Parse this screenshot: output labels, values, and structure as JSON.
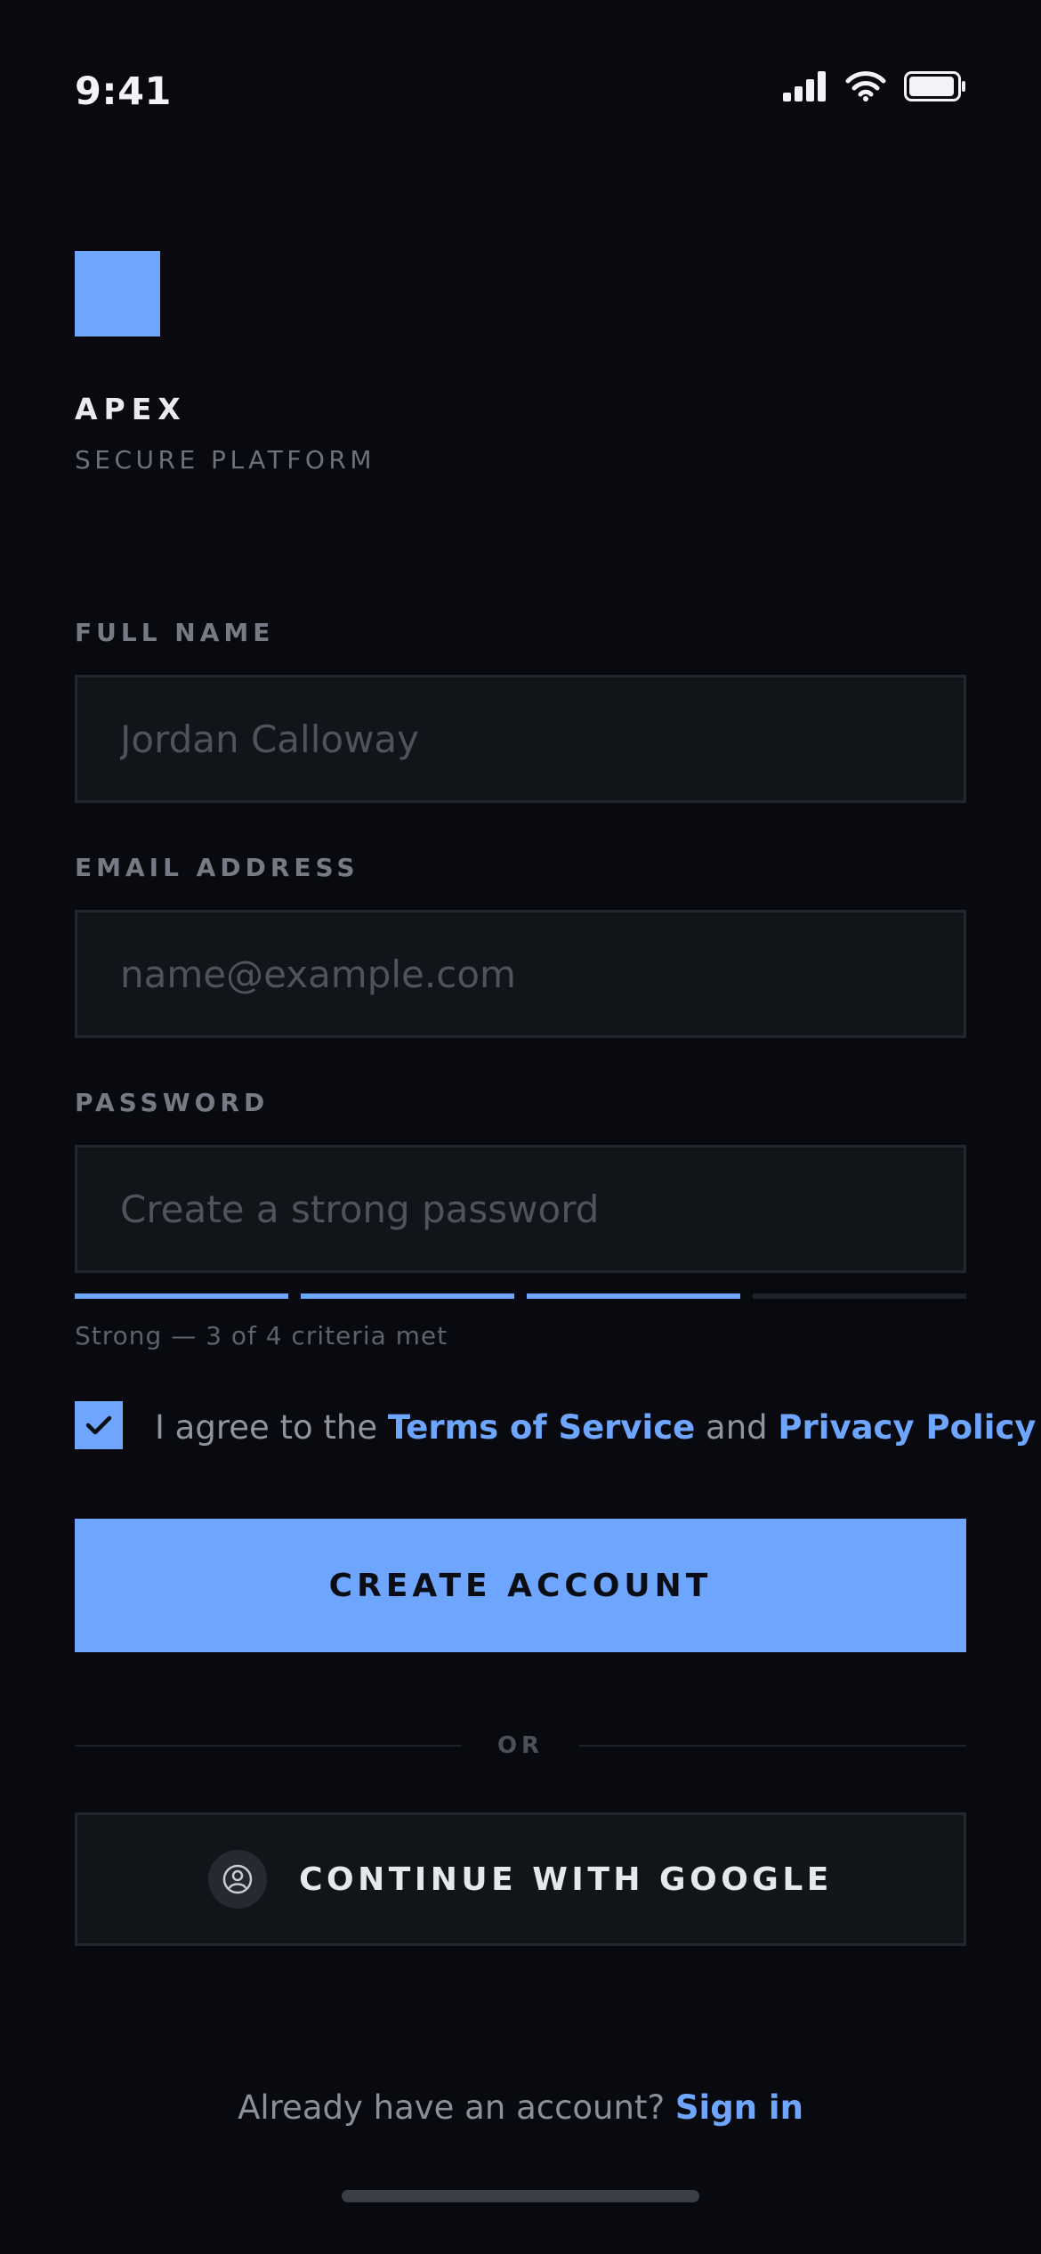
{
  "status_bar": {
    "time": "9:41"
  },
  "brand": {
    "name": "APEX",
    "tagline": "SECURE PLATFORM",
    "color": "#6ea6ff"
  },
  "form": {
    "full_name": {
      "label": "FULL NAME",
      "placeholder": "Jordan Calloway",
      "value": ""
    },
    "email": {
      "label": "EMAIL ADDRESS",
      "placeholder": "name@example.com",
      "value": ""
    },
    "password": {
      "label": "PASSWORD",
      "placeholder": "Create a strong password",
      "value": ""
    },
    "strength": {
      "criteria_met": 3,
      "criteria_total": 4,
      "text": "Strong — 3 of 4 criteria met"
    },
    "terms": {
      "checked": true,
      "prefix": "I agree to the ",
      "terms_link": "Terms of Service",
      "middle": " and ",
      "privacy_link": "Privacy Policy"
    },
    "submit_label": "CREATE ACCOUNT"
  },
  "divider_text": "OR",
  "google": {
    "label": "CONTINUE WITH GOOGLE",
    "icon": "user-circle-icon"
  },
  "signin": {
    "prompt": "Already have an account? ",
    "link": "Sign in"
  },
  "colors": {
    "accent": "#6ea6ff",
    "background": "#080a0f",
    "input_bg": "#111419"
  }
}
